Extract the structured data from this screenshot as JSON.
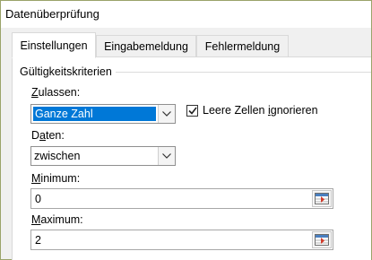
{
  "window": {
    "title": "Datenüberprüfung"
  },
  "tabs": [
    {
      "label": "Einstellungen",
      "active": true
    },
    {
      "label": "Eingabemeldung",
      "active": false
    },
    {
      "label": "Fehlermeldung",
      "active": false
    }
  ],
  "criteria": {
    "group_label": "Gültigkeitskriterien",
    "allow": {
      "label_mnemonic": "Z",
      "label_rest": "ulassen:",
      "value": "Ganze Zahl"
    },
    "ignore_blank": {
      "label_pre": "Leere Zellen ",
      "label_mnemonic": "i",
      "label_post": "gnorieren",
      "checked": true
    },
    "data": {
      "label_pre": "D",
      "label_mnemonic": "a",
      "label_post": "ten:",
      "value": "zwischen"
    },
    "minimum": {
      "label_mnemonic": "M",
      "label_rest": "inimum:",
      "value": "0"
    },
    "maximum": {
      "label_mnemonic": "M",
      "label_rest": "aximum:",
      "value": "2"
    }
  },
  "icons": {
    "dropdown": "chevron-down-icon",
    "range_select": "collapse-dialog-icon",
    "checkmark": "checkmark-icon"
  },
  "colors": {
    "selection": "#0078d7",
    "frame_border": "#9aa36a",
    "dialog_bg": "#f0f0f0"
  }
}
